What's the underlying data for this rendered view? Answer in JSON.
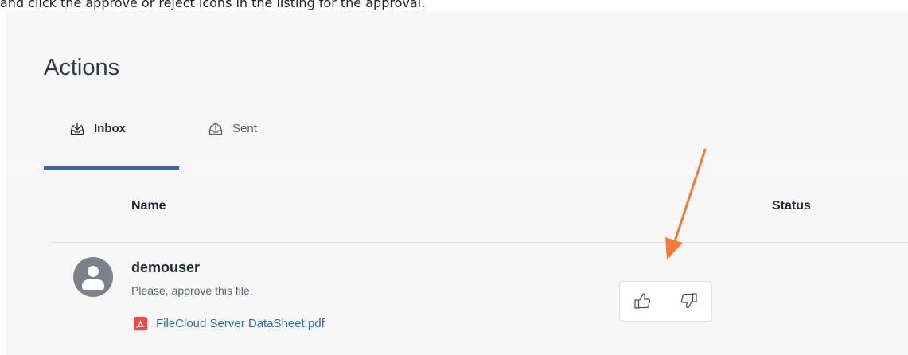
{
  "instruction_caption": "and click the approve or reject icons in the listing for the approval.",
  "page": {
    "title": "Actions"
  },
  "tabs": [
    {
      "label": "Inbox",
      "icon": "inbox-tray-icon",
      "active": true
    },
    {
      "label": "Sent",
      "icon": "outbox-tray-icon",
      "active": false
    }
  ],
  "table": {
    "columns": [
      "Name",
      "Status"
    ],
    "rows": [
      {
        "sender": "demouser",
        "message": "Please, approve this file.",
        "file_name": "FileCloud Server DataSheet.pdf",
        "file_icon": "pdf-icon",
        "actions": [
          "approve (thumbs-up-icon)",
          "reject (thumbs-down-icon)"
        ]
      }
    ]
  },
  "colors": {
    "accent": "#2a6cb2",
    "annotation_arrow": "#f47a3c",
    "pdf_icon": "#e94b4b",
    "avatar": "#7b8189"
  }
}
